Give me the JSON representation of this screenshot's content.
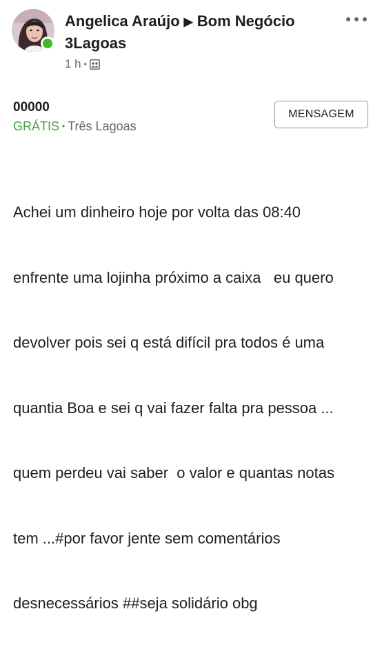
{
  "post": {
    "author": "Angelica Araújo",
    "group": "Bom Negócio 3Lagoas",
    "time": "1 h",
    "privacy_icon": "group-members-icon",
    "more_icon": "more-options-icon",
    "avatar_icon": "profile-photo"
  },
  "listing": {
    "title": "00000",
    "price": "GRÁTIS",
    "location": "Três Lagoas",
    "message_button": "MENSAGEM"
  },
  "body_lines": [
    "Achei um dinheiro hoje por volta das 08:40",
    "enfrente uma lojinha próximo a caixa   eu quero",
    "devolver pois sei q está difícil pra todos é uma",
    "quantia Boa e sei q vai fazer falta pra pessoa ...",
    "quem perdeu vai saber  o valor e quantas notas",
    "tem ...#por favor jente sem comentários",
    "desnecessários ##seja solidário obg"
  ],
  "colors": {
    "online": "#42b72a",
    "price": "#42a33b",
    "meta": "#606770"
  }
}
